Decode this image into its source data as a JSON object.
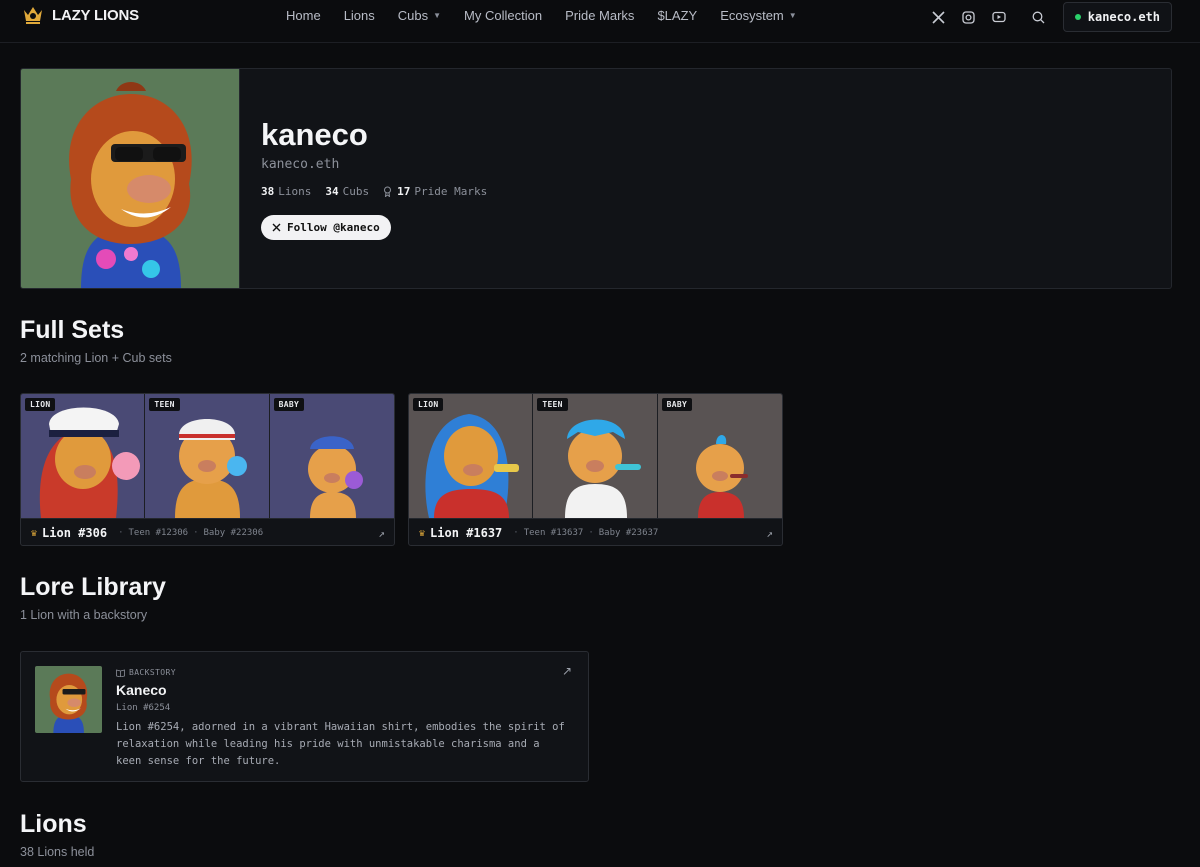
{
  "nav": {
    "brand": "LAZY LIONS",
    "links": [
      {
        "label": "Home",
        "dropdown": false
      },
      {
        "label": "Lions",
        "dropdown": false
      },
      {
        "label": "Cubs",
        "dropdown": true
      },
      {
        "label": "My Collection",
        "dropdown": false
      },
      {
        "label": "Pride Marks",
        "dropdown": false
      },
      {
        "label": "$LAZY",
        "dropdown": false
      },
      {
        "label": "Ecosystem",
        "dropdown": true
      }
    ],
    "social_icons": [
      "x-icon",
      "instagram-icon",
      "youtube-icon"
    ],
    "wallet_label": "kaneco.eth",
    "wallet_status_color": "#2ad16a"
  },
  "profile": {
    "name": "kaneco",
    "ens": "kaneco.eth",
    "stats": [
      {
        "value": "38",
        "label": "Lions"
      },
      {
        "value": "34",
        "label": "Cubs"
      },
      {
        "value": "17",
        "label": "Pride Marks"
      }
    ],
    "follow_label": "Follow @kaneco",
    "avatar_bg": "#5b7a58"
  },
  "full_sets": {
    "title": "Full Sets",
    "subtitle": "2 matching Lion + Cub sets",
    "sets": [
      {
        "bg": "#4a4a75",
        "badges": [
          "LION",
          "TEEN",
          "BABY"
        ],
        "main": "Lion #306",
        "teen": "Teen #12306",
        "baby": "Baby #22306"
      },
      {
        "bg": "#595353",
        "badges": [
          "LION",
          "TEEN",
          "BABY"
        ],
        "main": "Lion #1637",
        "teen": "Teen #13637",
        "baby": "Baby #23637"
      }
    ]
  },
  "lore": {
    "title": "Lore Library",
    "subtitle": "1 Lion with a backstory",
    "tag": "BACKSTORY",
    "name": "Kaneco",
    "id": "Lion #6254",
    "text": "Lion #6254, adorned in a vibrant Hawaiian shirt, embodies the spirit of relaxation while leading his pride with unmistakable charisma and a keen sense for the future."
  },
  "lions": {
    "title": "Lions",
    "subtitle": "38 Lions held"
  }
}
